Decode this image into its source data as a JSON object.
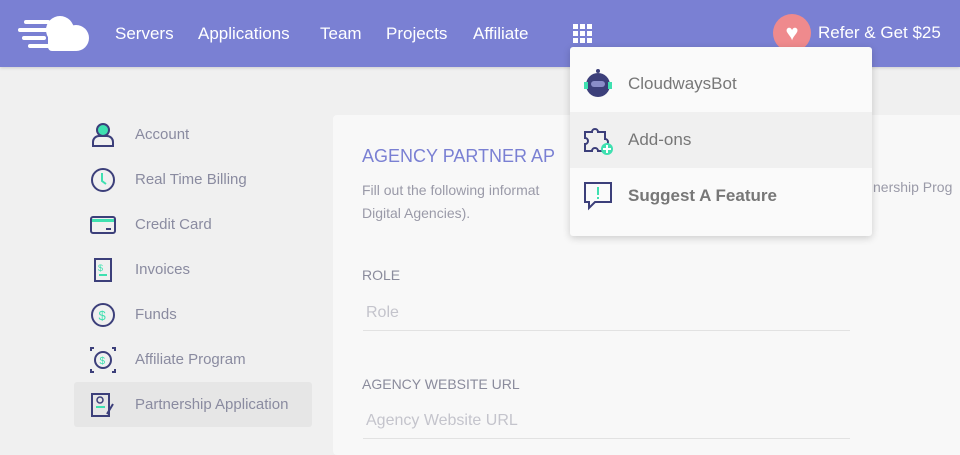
{
  "header": {
    "nav": [
      "Servers",
      "Applications",
      "Team",
      "Projects",
      "Affiliate"
    ],
    "refer_label": "Refer & Get $25"
  },
  "sidebar": {
    "items": [
      {
        "label": "Account",
        "icon": "account-icon"
      },
      {
        "label": "Real Time Billing",
        "icon": "clock-icon"
      },
      {
        "label": "Credit Card",
        "icon": "credit-card-icon"
      },
      {
        "label": "Invoices",
        "icon": "invoice-icon"
      },
      {
        "label": "Funds",
        "icon": "dollar-icon"
      },
      {
        "label": "Affiliate Program",
        "icon": "affiliate-icon"
      },
      {
        "label": "Partnership Application",
        "icon": "partnership-icon",
        "active": true
      }
    ]
  },
  "card": {
    "title": "AGENCY PARTNER AP",
    "desc_line1": "Fill out the following informat",
    "desc_frag": "nership Prog",
    "desc_line2": "Digital Agencies).",
    "role_label": "ROLE",
    "role_placeholder": "Role",
    "url_label": "AGENCY WEBSITE URL",
    "url_placeholder": "Agency Website URL"
  },
  "dropdown": {
    "items": [
      "CloudwaysBot",
      "Add-ons",
      "Suggest A Feature"
    ]
  },
  "colors": {
    "header": "#7a80d3",
    "accent_green": "#3fe0b0",
    "icon_navy": "#3c3f7a",
    "heart": "#ef8a8d"
  }
}
